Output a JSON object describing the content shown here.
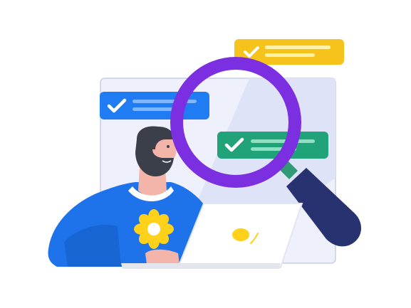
{
  "illustration": {
    "subject": "person-with-laptop-and-magnifier",
    "colors": {
      "panel": "#eef0fb",
      "panel_border": "#c9cde3",
      "panel_stripe": "#dfe3f8",
      "card_blue": "#1f7cf2",
      "card_green": "#21a37a",
      "card_yellow": "#f6c31c",
      "card_line_blue": "#7fb6ff",
      "card_line_green": "#8fe0c3",
      "card_line_yellow": "#fff2a8",
      "magnifier_ring": "#7b2fe0",
      "magnifier_handle": "#283271",
      "magnifier_neck": "#2f9a73",
      "shirt": "#1e73ea",
      "skin": "#f3b5a9",
      "hair": "#3b3f4a",
      "flower_petal": "#ffd11a",
      "laptop": "#ffffff",
      "laptop_outline": "#e4e6ee",
      "laptop_logo": "#ffd11a"
    },
    "cards": [
      {
        "name": "blue-check-card",
        "icon": "check-icon",
        "color": "#1f7cf2"
      },
      {
        "name": "green-check-card",
        "icon": "check-icon",
        "color": "#21a37a"
      },
      {
        "name": "yellow-check-card",
        "icon": "check-icon",
        "color": "#f6c31c"
      }
    ]
  }
}
